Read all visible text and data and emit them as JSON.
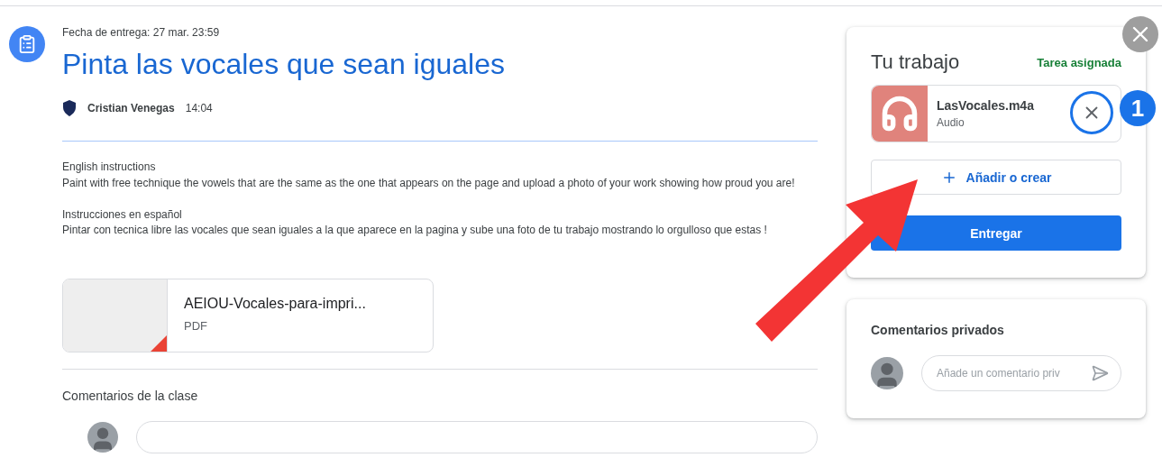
{
  "assignment": {
    "due": "Fecha de entrega: 27 mar. 23:59",
    "title": "Pinta las vocales que sean iguales",
    "author": "Cristian Venegas",
    "time": "14:04",
    "instructions": [
      {
        "heading": "English instructions",
        "text": "Paint with free technique the vowels that are the same as the one that appears on the page and upload a photo of your work showing how proud you are!"
      },
      {
        "heading": "Instrucciones en español",
        "text": "Pintar con tecnica libre las vocales que sean iguales a la que aparece en la pagina y sube una foto de tu trabajo mostrando lo orgulloso que estas !"
      }
    ],
    "attachment": {
      "name": "AEIOU-Vocales-para-impri...",
      "type": "PDF"
    },
    "class_comments": {
      "title": "Comentarios de la clase"
    }
  },
  "your_work": {
    "title": "Tu trabajo",
    "status": "Tarea asignada",
    "files": [
      {
        "name": "LasVocales.m4a",
        "type": "Audio"
      }
    ],
    "add_button": "Añadir o crear",
    "submit_button": "Entregar"
  },
  "private_comments": {
    "title": "Comentarios privados",
    "placeholder": "Añade un comentario priv"
  },
  "annotation": {
    "badge": "1"
  }
}
